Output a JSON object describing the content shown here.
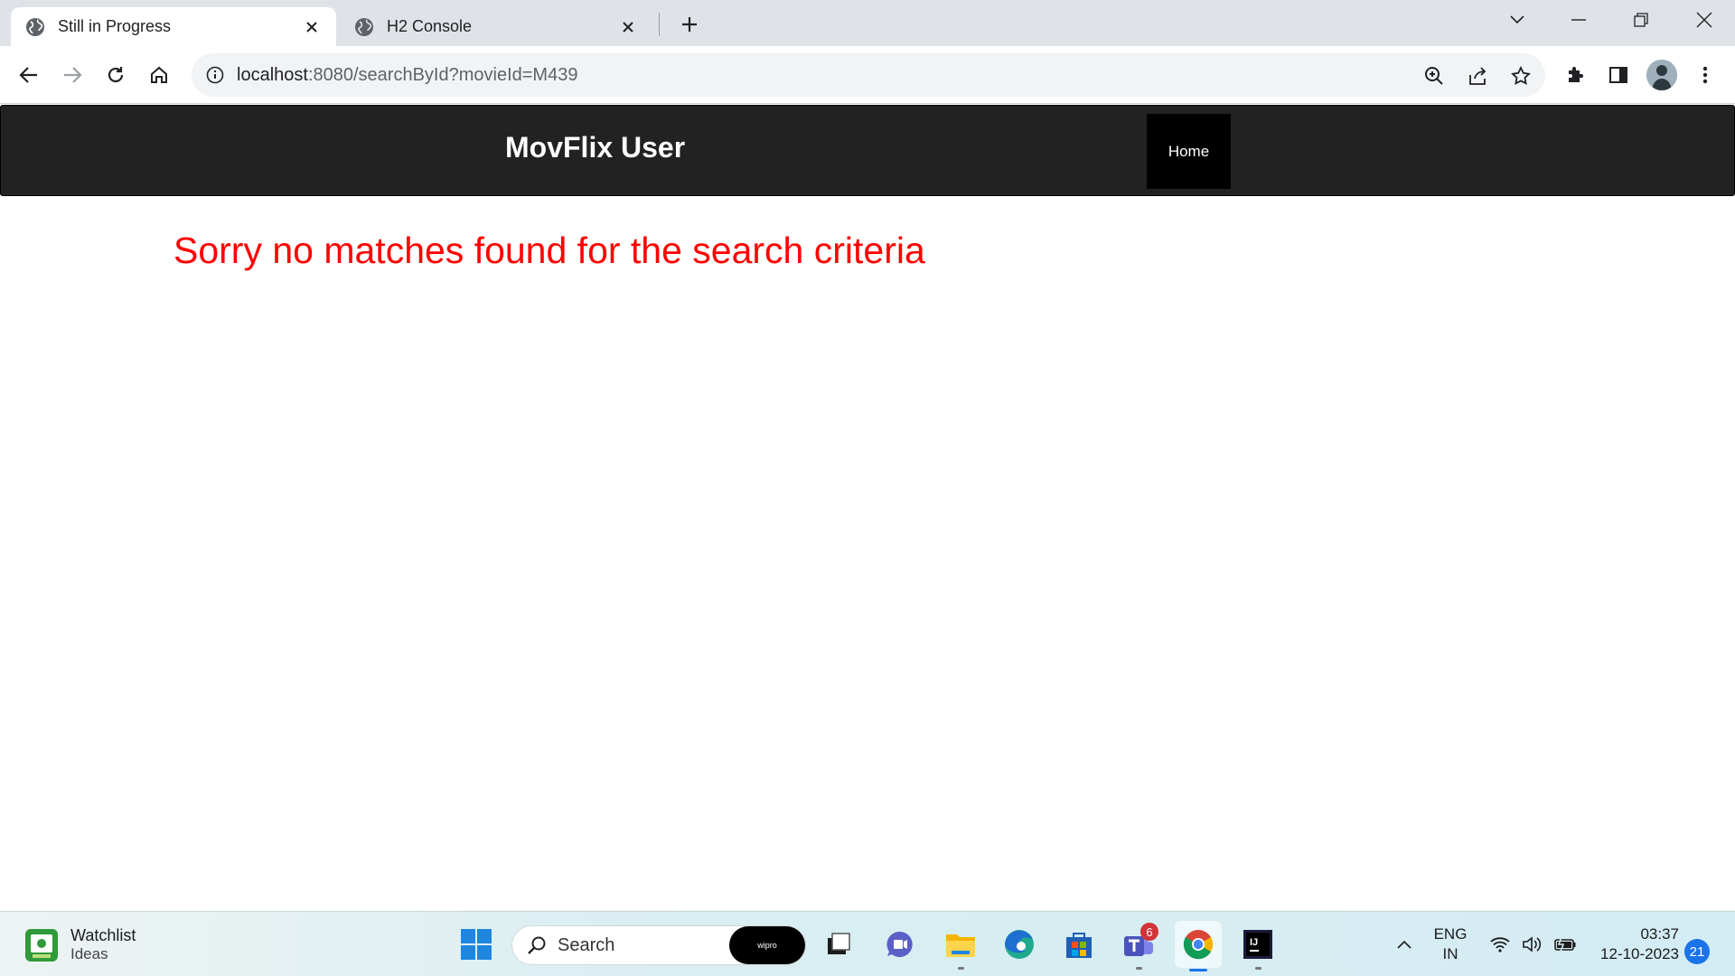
{
  "browser": {
    "tabs": [
      {
        "title": "Still in Progress",
        "active": true
      },
      {
        "title": "H2 Console",
        "active": false
      }
    ],
    "url": {
      "host": "localhost",
      "rest": ":8080/searchById?movieId=M439"
    },
    "colors": {
      "tabstrip": "#dfe3e8",
      "omnibox": "#f1f3f4"
    }
  },
  "page": {
    "brand": "MovFlix User",
    "nav": {
      "home_label": "Home"
    },
    "message": "Sorry no matches found for the search criteria",
    "colors": {
      "navbar": "#222222",
      "message": "#ff0000"
    }
  },
  "taskbar": {
    "widget": {
      "title": "Watchlist",
      "subtitle": "Ideas"
    },
    "search_placeholder": "Search",
    "search_pill": "wipro",
    "teams_badge": "6",
    "language": {
      "line1": "ENG",
      "line2": "IN"
    },
    "time": "03:37",
    "date": "12-10-2023",
    "notification_count": "21"
  }
}
